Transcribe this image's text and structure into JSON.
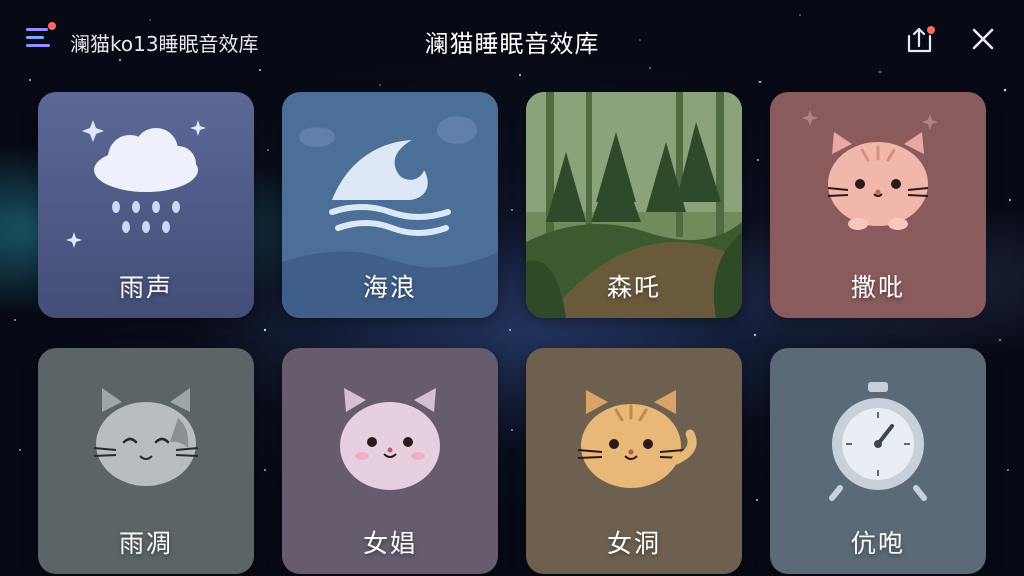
{
  "header": {
    "small_title": "澜猫ko13睡眠音效库",
    "title": "澜猫睡眠音效库",
    "menu_icon": "menu-icon",
    "share_icon": "share-icon",
    "close_icon": "close-icon",
    "accent_color": "#ff6a5c"
  },
  "cards": [
    {
      "label": "雨声",
      "icon": "rain-cloud-icon",
      "color": "#4c5985"
    },
    {
      "label": "海浪",
      "icon": "wave-icon",
      "color": "#4c6f98"
    },
    {
      "label": "森吒",
      "icon": "forest-icon",
      "color": "#3f5a34"
    },
    {
      "label": "撒吡",
      "icon": "pink-cat-icon",
      "color": "#8a5b5d"
    },
    {
      "label": "雨凋",
      "icon": "gray-cat-icon",
      "color": "#5b6466"
    },
    {
      "label": "女娼",
      "icon": "lilac-cat-icon",
      "color": "#665c6e"
    },
    {
      "label": "女洞",
      "icon": "orange-cat-icon",
      "color": "#6e604f"
    },
    {
      "label": "伉咆",
      "icon": "stopwatch-icon",
      "color": "#5b6a77"
    }
  ]
}
